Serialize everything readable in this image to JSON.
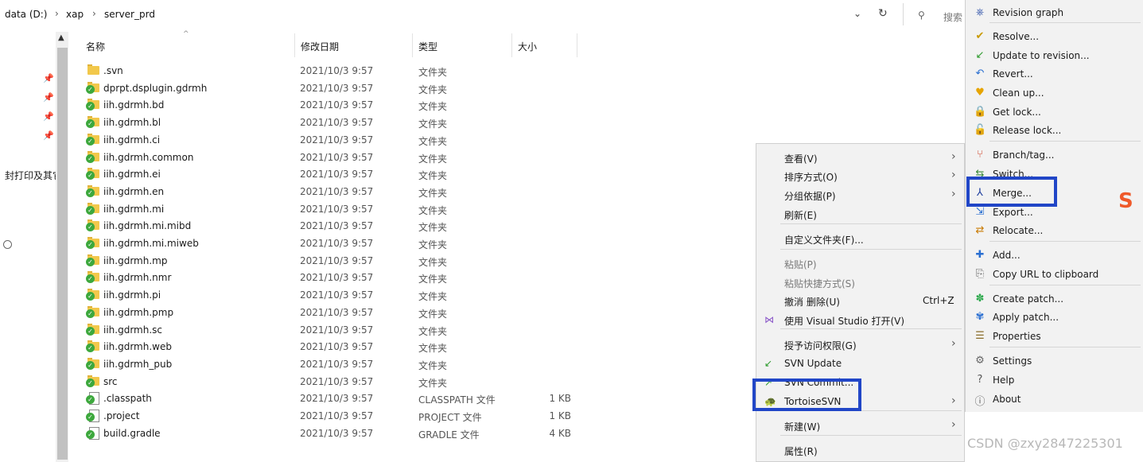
{
  "breadcrumb": [
    "data (D:)",
    "xap",
    "server_prd"
  ],
  "search_placeholder": "搜索",
  "nav": {
    "truncated_text": "封打印及其它"
  },
  "columns": {
    "name": "名称",
    "date": "修改日期",
    "type": "类型",
    "size": "大小"
  },
  "files": [
    {
      "name": ".svn",
      "date": "2021/10/3 9:57",
      "type": "文件夹",
      "size": "",
      "kind": "folder-plain"
    },
    {
      "name": "dprpt.dsplugin.gdrmh",
      "date": "2021/10/3 9:57",
      "type": "文件夹",
      "size": "",
      "kind": "folder-ok"
    },
    {
      "name": "iih.gdrmh.bd",
      "date": "2021/10/3 9:57",
      "type": "文件夹",
      "size": "",
      "kind": "folder-ok"
    },
    {
      "name": "iih.gdrmh.bl",
      "date": "2021/10/3 9:57",
      "type": "文件夹",
      "size": "",
      "kind": "folder-ok"
    },
    {
      "name": "iih.gdrmh.ci",
      "date": "2021/10/3 9:57",
      "type": "文件夹",
      "size": "",
      "kind": "folder-ok"
    },
    {
      "name": "iih.gdrmh.common",
      "date": "2021/10/3 9:57",
      "type": "文件夹",
      "size": "",
      "kind": "folder-ok"
    },
    {
      "name": "iih.gdrmh.ei",
      "date": "2021/10/3 9:57",
      "type": "文件夹",
      "size": "",
      "kind": "folder-ok"
    },
    {
      "name": "iih.gdrmh.en",
      "date": "2021/10/3 9:57",
      "type": "文件夹",
      "size": "",
      "kind": "folder-ok"
    },
    {
      "name": "iih.gdrmh.mi",
      "date": "2021/10/3 9:57",
      "type": "文件夹",
      "size": "",
      "kind": "folder-ok"
    },
    {
      "name": "iih.gdrmh.mi.mibd",
      "date": "2021/10/3 9:57",
      "type": "文件夹",
      "size": "",
      "kind": "folder-ok"
    },
    {
      "name": "iih.gdrmh.mi.miweb",
      "date": "2021/10/3 9:57",
      "type": "文件夹",
      "size": "",
      "kind": "folder-ok"
    },
    {
      "name": "iih.gdrmh.mp",
      "date": "2021/10/3 9:57",
      "type": "文件夹",
      "size": "",
      "kind": "folder-ok"
    },
    {
      "name": "iih.gdrmh.nmr",
      "date": "2021/10/3 9:57",
      "type": "文件夹",
      "size": "",
      "kind": "folder-ok"
    },
    {
      "name": "iih.gdrmh.pi",
      "date": "2021/10/3 9:57",
      "type": "文件夹",
      "size": "",
      "kind": "folder-ok"
    },
    {
      "name": "iih.gdrmh.pmp",
      "date": "2021/10/3 9:57",
      "type": "文件夹",
      "size": "",
      "kind": "folder-ok"
    },
    {
      "name": "iih.gdrmh.sc",
      "date": "2021/10/3 9:57",
      "type": "文件夹",
      "size": "",
      "kind": "folder-ok"
    },
    {
      "name": "iih.gdrmh.web",
      "date": "2021/10/3 9:57",
      "type": "文件夹",
      "size": "",
      "kind": "folder-ok"
    },
    {
      "name": "iih.gdrmh_pub",
      "date": "2021/10/3 9:57",
      "type": "文件夹",
      "size": "",
      "kind": "folder-ok"
    },
    {
      "name": "src",
      "date": "2021/10/3 9:57",
      "type": "文件夹",
      "size": "",
      "kind": "folder-ok"
    },
    {
      "name": ".classpath",
      "date": "2021/10/3 9:57",
      "type": "CLASSPATH 文件",
      "size": "1 KB",
      "kind": "file-ok"
    },
    {
      "name": ".project",
      "date": "2021/10/3 9:57",
      "type": "PROJECT 文件",
      "size": "1 KB",
      "kind": "file-ok"
    },
    {
      "name": "build.gradle",
      "date": "2021/10/3 9:57",
      "type": "GRADLE 文件",
      "size": "4 KB",
      "kind": "file-ok"
    }
  ],
  "context_menu": {
    "items": [
      {
        "label": "查看(V)",
        "submenu": true
      },
      {
        "label": "排序方式(O)",
        "submenu": true
      },
      {
        "label": "分组依据(P)",
        "submenu": true
      },
      {
        "label": "刷新(E)"
      },
      {
        "label": "自定义文件夹(F)..."
      },
      {
        "label": "粘贴(P)",
        "disabled": true
      },
      {
        "label": "粘贴快捷方式(S)",
        "disabled": true
      },
      {
        "label": "撤消 删除(U)",
        "shortcut": "Ctrl+Z"
      },
      {
        "label": "使用 Visual Studio 打开(V)",
        "icon": "visual-studio-icon"
      },
      {
        "label": "授予访问权限(G)",
        "submenu": true
      },
      {
        "label": "SVN Update",
        "icon": "svn-update-icon"
      },
      {
        "label": "SVN Commit...",
        "icon": "svn-commit-icon"
      },
      {
        "label": "TortoiseSVN",
        "submenu": true,
        "icon": "tortoise-icon"
      },
      {
        "label": "新建(W)",
        "submenu": true
      },
      {
        "label": "属性(R)"
      }
    ]
  },
  "svn_menu": {
    "items": [
      {
        "label": "Revision graph",
        "icon": "revision-graph-icon"
      },
      {
        "label": "Resolve...",
        "icon": "resolve-icon"
      },
      {
        "label": "Update to revision...",
        "icon": "update-to-revision-icon"
      },
      {
        "label": "Revert...",
        "icon": "revert-icon"
      },
      {
        "label": "Clean up...",
        "icon": "cleanup-icon"
      },
      {
        "label": "Get lock...",
        "icon": "lock-icon"
      },
      {
        "label": "Release lock...",
        "icon": "unlock-icon"
      },
      {
        "label": "Branch/tag...",
        "icon": "branch-icon"
      },
      {
        "label": "Switch...",
        "icon": "switch-icon"
      },
      {
        "label": "Merge...",
        "icon": "merge-icon"
      },
      {
        "label": "Export...",
        "icon": "export-icon"
      },
      {
        "label": "Relocate...",
        "icon": "relocate-icon"
      },
      {
        "label": "Add...",
        "icon": "add-icon"
      },
      {
        "label": "Copy URL to clipboard",
        "icon": "copy-url-icon"
      },
      {
        "label": "Create patch...",
        "icon": "create-patch-icon"
      },
      {
        "label": "Apply patch...",
        "icon": "apply-patch-icon"
      },
      {
        "label": "Properties",
        "icon": "properties-icon"
      },
      {
        "label": "Settings",
        "icon": "settings-icon"
      },
      {
        "label": "Help",
        "icon": "help-icon"
      },
      {
        "label": "About",
        "icon": "about-icon"
      }
    ]
  },
  "watermark": "CSDN @zxy2847225301",
  "colors": {
    "highlight_border": "#2146c7",
    "svn_ok": "#3da83d",
    "folder": "#f2c84b"
  }
}
